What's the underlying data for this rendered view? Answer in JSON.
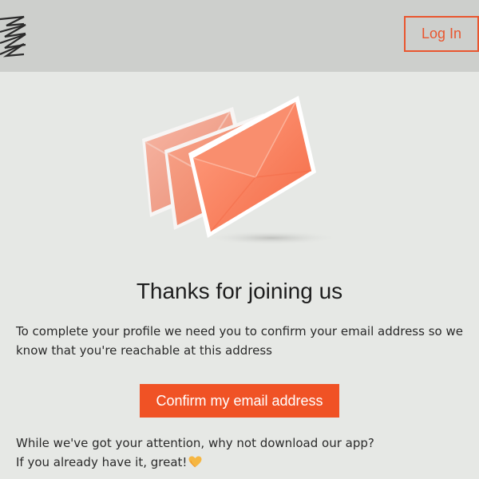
{
  "header": {
    "logo_icon": "stacked-chevrons-logo",
    "login_label": "Log In"
  },
  "hero": {
    "icon": "envelopes-illustration"
  },
  "main": {
    "title": "Thanks for joining us",
    "body_line1": "To complete your profile we need you to confirm your email address so we",
    "body_line2": "know that you're reachable at this address",
    "confirm_label": "Confirm my email address",
    "footer_line1": "While we've got your attention, why not download our app?",
    "footer_line2": "If you already have it, great!",
    "footer_icon": "heart-icon"
  },
  "colors": {
    "accent": "#f05225",
    "header_bg": "#cdcfcc",
    "page_bg": "#e6e8e5"
  }
}
